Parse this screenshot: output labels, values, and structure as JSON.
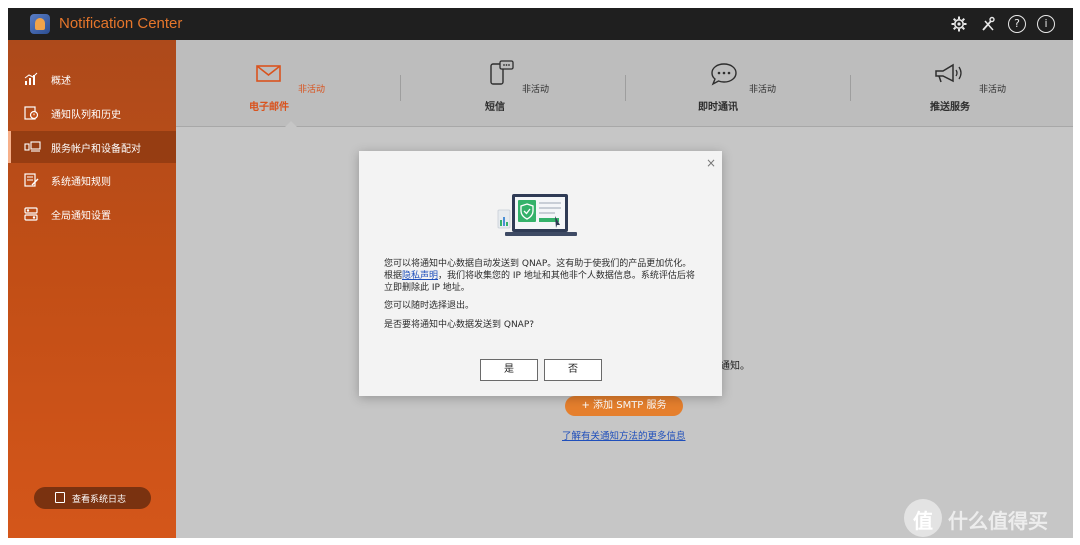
{
  "app": {
    "title": "Notification Center"
  },
  "titlebar": {
    "icons": [
      "gear-icon",
      "tools-icon",
      "help-icon",
      "info-icon"
    ],
    "help_glyph": "?",
    "info_glyph": "i"
  },
  "sidebar": {
    "items": [
      {
        "label": "概述",
        "icon": "chart-icon"
      },
      {
        "label": "通知队列和历史",
        "icon": "history-icon"
      },
      {
        "label": "服务帐户和设备配对",
        "icon": "pairing-icon",
        "active": true
      },
      {
        "label": "系统通知规则",
        "icon": "rules-icon"
      },
      {
        "label": "全局通知设置",
        "icon": "settings-icon"
      }
    ],
    "log_button": "查看系统日志"
  },
  "tabs": [
    {
      "label": "电子邮件",
      "status": "非活动",
      "icon": "email-icon",
      "active": true
    },
    {
      "label": "短信",
      "status": "非活动",
      "icon": "sms-icon"
    },
    {
      "label": "即时通讯",
      "status": "非活动",
      "icon": "chat-icon"
    },
    {
      "label": "推送服务",
      "status": "非活动",
      "icon": "megaphone-icon"
    }
  ],
  "content": {
    "partial_text": "通知。",
    "smtp_button": "+ 添加 SMTP 服务",
    "learn_more": "了解有关通知方法的更多信息"
  },
  "modal": {
    "close": "×",
    "paragraph1_a": "您可以将通知中心数据自动发送到 QNAP。这有助于使我们的产品更加优化。根据",
    "privacy_link": "隐私声明",
    "paragraph1_b": "，我们将收集您的 IP 地址和其他非个人数据信息。系统评估后将立即删除此 IP 地址。",
    "paragraph2": "您可以随时选择退出。",
    "paragraph3": "是否要将通知中心数据发送到 QNAP?",
    "yes": "是",
    "no": "否"
  },
  "watermark": {
    "text": "什么值得买",
    "logo_glyph": "值"
  },
  "colors": {
    "accent": "#e6762b",
    "sidebar": "#c14e16",
    "link": "#1f4fbb",
    "titlebar": "#1f1f1f"
  }
}
